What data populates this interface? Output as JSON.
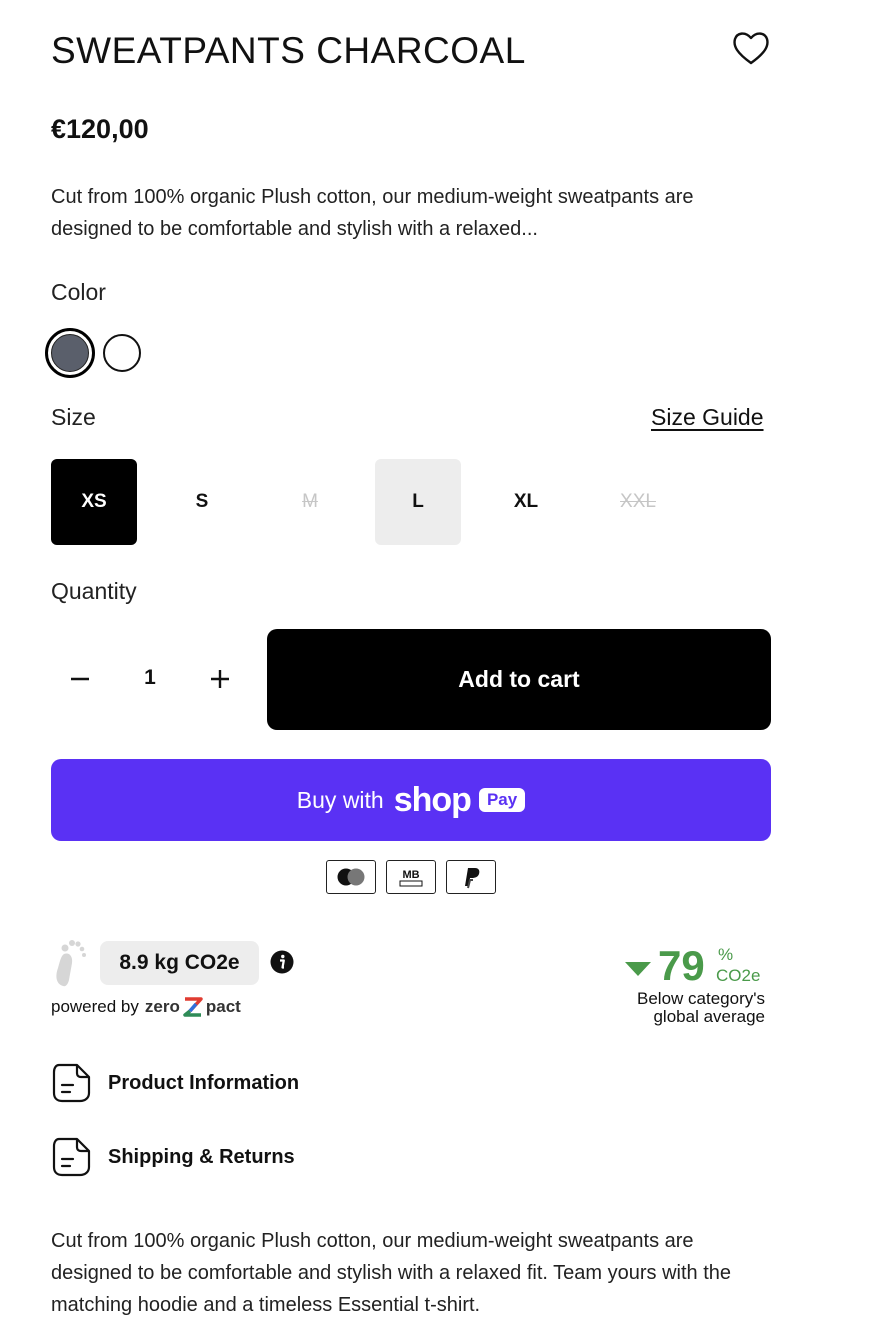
{
  "product": {
    "title": "SWEATPANTS CHARCOAL",
    "price": "€120,00",
    "short_description": "Cut from 100% organic Plush cotton, our medium-weight sweatpants are designed to be comfortable and stylish with a relaxed...",
    "long_description": "Cut from 100% organic Plush cotton, our medium-weight sweatpants are designed to be comfortable and stylish with a relaxed fit. Team yours with the matching hoodie and a timeless Essential t-shirt."
  },
  "color": {
    "label": "Color",
    "options": [
      {
        "name": "charcoal",
        "hex": "#5a5f6b",
        "selected": true
      },
      {
        "name": "white",
        "hex": "#ffffff",
        "selected": false
      }
    ]
  },
  "size": {
    "label": "Size",
    "guide_label": "Size Guide",
    "options": [
      {
        "label": "XS",
        "state": "selected"
      },
      {
        "label": "S",
        "state": "available"
      },
      {
        "label": "M",
        "state": "sold-out"
      },
      {
        "label": "L",
        "state": "hover"
      },
      {
        "label": "XL",
        "state": "available"
      },
      {
        "label": "XXL",
        "state": "sold-out"
      }
    ]
  },
  "quantity": {
    "label": "Quantity",
    "value": "1"
  },
  "actions": {
    "add_to_cart": "Add to cart",
    "shop_pay_buy": "Buy with",
    "shop_pay_shop": "shop",
    "shop_pay_pay": "Pay"
  },
  "payment_methods": [
    "mastercard-icon",
    "multibanco-icon",
    "paypal-icon"
  ],
  "payment_mb_text": "MB",
  "carbon": {
    "footprint": "8.9 kg CO2e",
    "powered_by": "powered by",
    "brand_left": "zero",
    "brand_right": "pact",
    "compare_value": "79",
    "compare_pct": "%",
    "compare_unit": "CO2e",
    "compare_text_1": "Below category's",
    "compare_text_2": "global average"
  },
  "accordion": [
    {
      "label": "Product Information"
    },
    {
      "label": "Shipping & Returns"
    }
  ],
  "colors": {
    "shop_pay": "#5a31f4",
    "green": "#4a9a4a",
    "charcoal": "#5a5f6b"
  }
}
